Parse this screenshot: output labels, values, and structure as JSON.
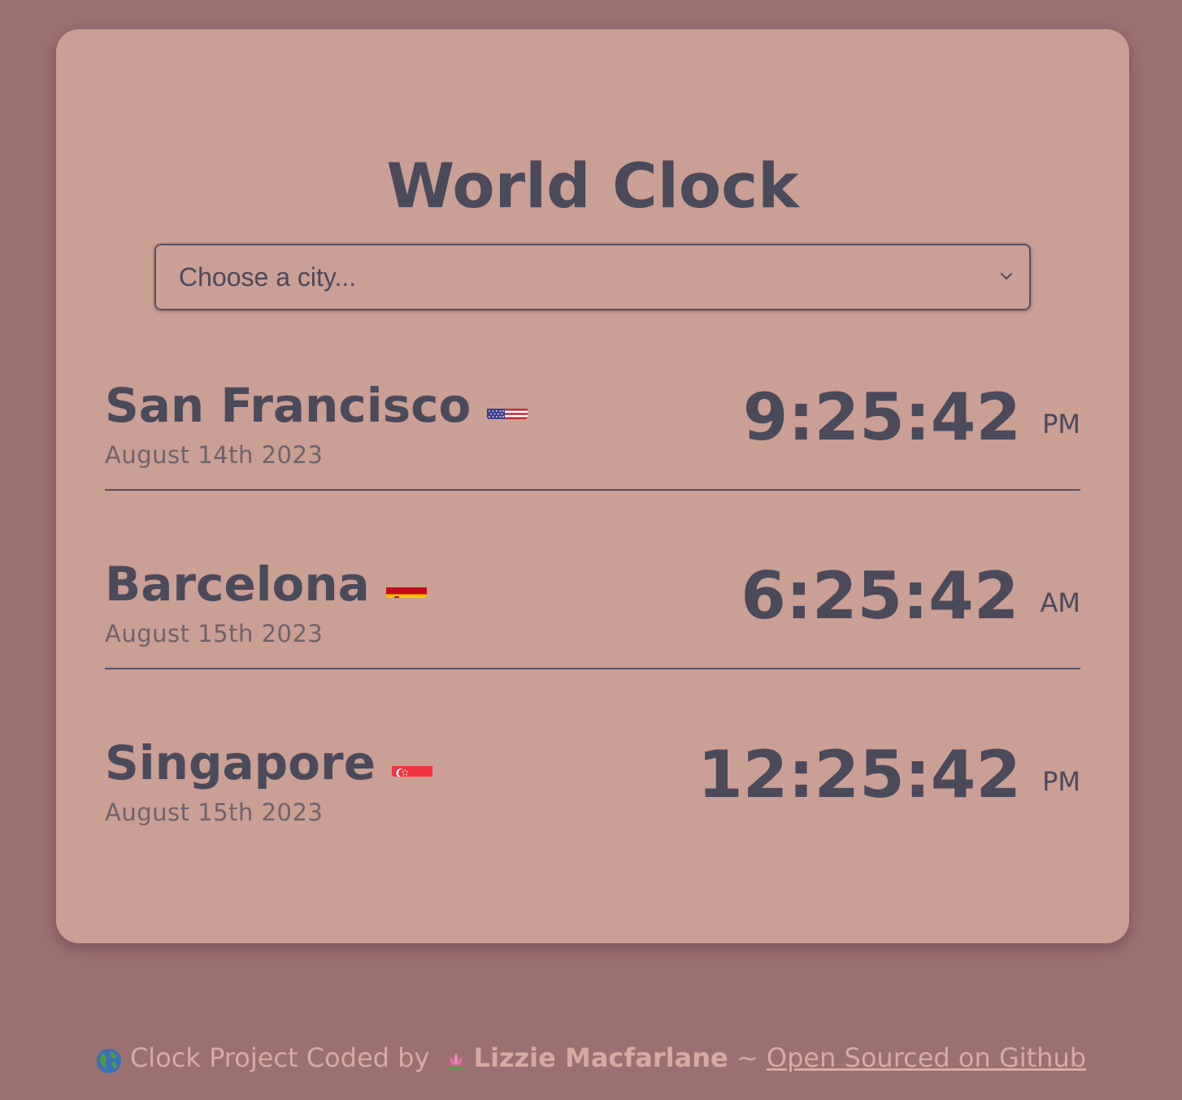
{
  "page": {
    "title": "World Clock"
  },
  "city_select": {
    "placeholder": "Choose a city...",
    "icon": "chevron-down-icon"
  },
  "cities": [
    {
      "name": "San Francisco",
      "flag": "us-flag-icon",
      "date": "August 14th 2023",
      "time": "9:25:42",
      "ampm": "PM"
    },
    {
      "name": "Barcelona",
      "flag": "spain-flag-icon",
      "date": "August 15th 2023",
      "time": "6:25:42",
      "ampm": "AM"
    },
    {
      "name": "Singapore",
      "flag": "singapore-flag-icon",
      "date": "August 15th 2023",
      "time": "12:25:42",
      "ampm": "PM"
    }
  ],
  "footer": {
    "globe_icon": "globe-icon",
    "prefix": "Clock Project Coded by",
    "lotus_icon": "lotus-icon",
    "author": "Lizzie Macfarlane",
    "separator": "~",
    "link_text": "Open Sourced on Github"
  },
  "colors": {
    "background": "#9b7070",
    "card": "#ca9f94",
    "text": "#4a4a5b",
    "muted_text": "#6f6369",
    "footer_text": "#d6aba2"
  }
}
